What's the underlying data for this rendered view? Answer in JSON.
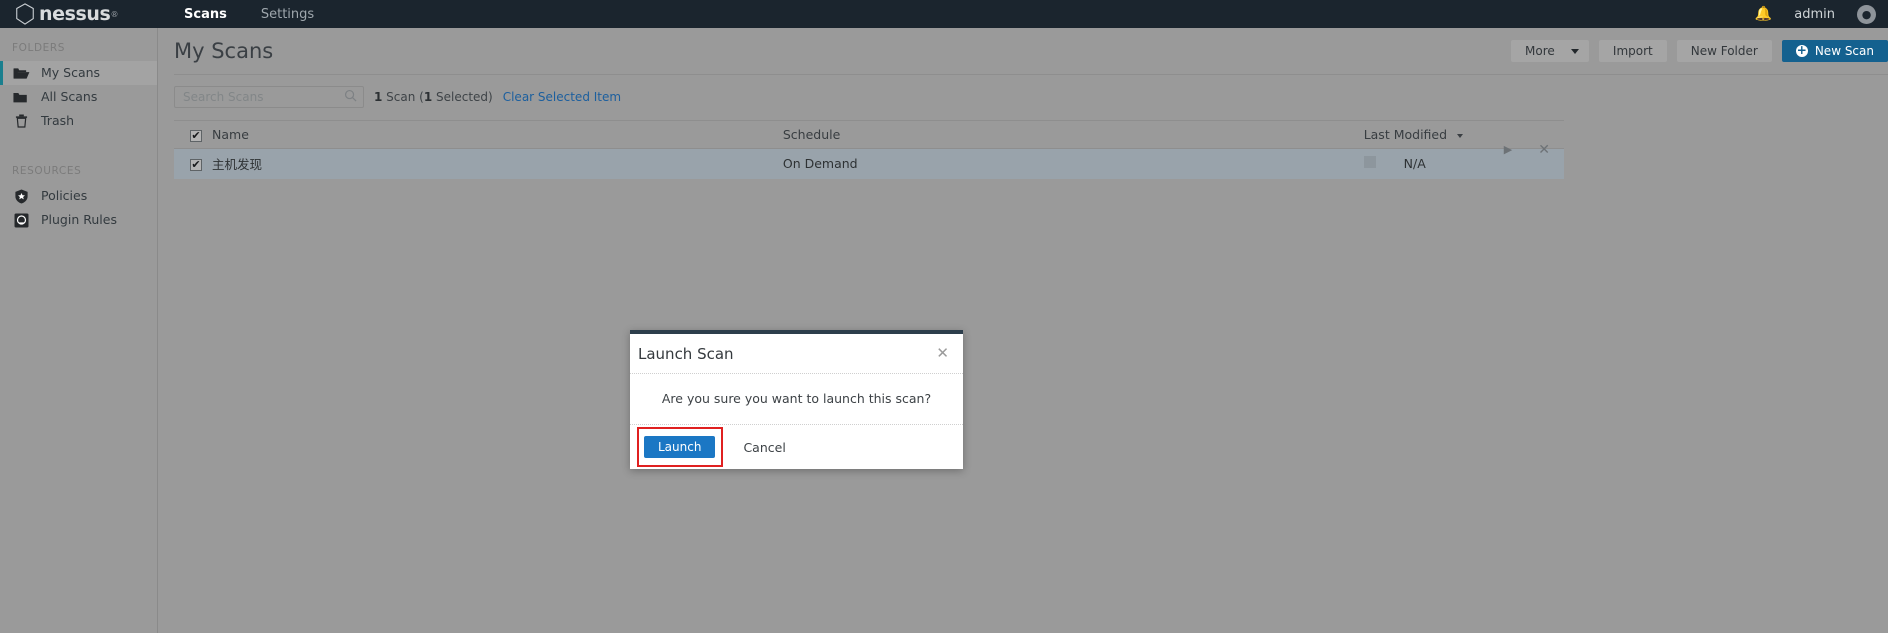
{
  "topnav": {
    "brand": "nessus",
    "brand_tm": "®",
    "brand_icon": "hexagon-logo-icon",
    "items": [
      {
        "label": "Scans",
        "active": true
      },
      {
        "label": "Settings",
        "active": false
      }
    ],
    "bell_icon": "notification-bell-icon",
    "user": "admin",
    "avatar_icon": "user-avatar-icon"
  },
  "sidebar": {
    "folders_heading": "FOLDERS",
    "folders": [
      {
        "label": "My Scans",
        "icon": "folder-open-icon",
        "active": true
      },
      {
        "label": "All Scans",
        "icon": "folder-icon",
        "active": false
      },
      {
        "label": "Trash",
        "icon": "trash-icon",
        "active": false
      }
    ],
    "resources_heading": "RESOURCES",
    "resources": [
      {
        "label": "Policies",
        "icon": "shield-star-icon"
      },
      {
        "label": "Plugin Rules",
        "icon": "plugin-icon"
      }
    ]
  },
  "page": {
    "title": "My Scans",
    "actions": {
      "more": "More",
      "more_caret_icon": "chevron-down-icon",
      "import": "Import",
      "new_folder": "New Folder",
      "new_scan": "New Scan",
      "new_scan_icon": "plus-circle-icon"
    }
  },
  "toolbar": {
    "search_placeholder": "Search Scans",
    "search_value": "",
    "search_icon": "search-icon",
    "count_prefix": "1",
    "count_mid": " Scan (",
    "count_selected": "1",
    "count_suffix": " Selected)",
    "clear_link": "Clear Selected Item"
  },
  "table": {
    "columns": {
      "name": "Name",
      "schedule": "Schedule",
      "last_modified": "Last Modified"
    },
    "sort_icon": "sort-desc-caret-icon",
    "header_checkbox_checked": true,
    "rows": [
      {
        "checked": true,
        "name": "主机发现",
        "schedule": "On Demand",
        "last_modified": "N/A",
        "launch_icon": "play-icon",
        "delete_icon": "close-icon"
      }
    ]
  },
  "modal": {
    "title": "Launch Scan",
    "close_icon": "close-icon",
    "message": "Are you sure you want to launch this scan?",
    "confirm_label": "Launch",
    "cancel_label": "Cancel",
    "highlight_color": "#e02020"
  }
}
